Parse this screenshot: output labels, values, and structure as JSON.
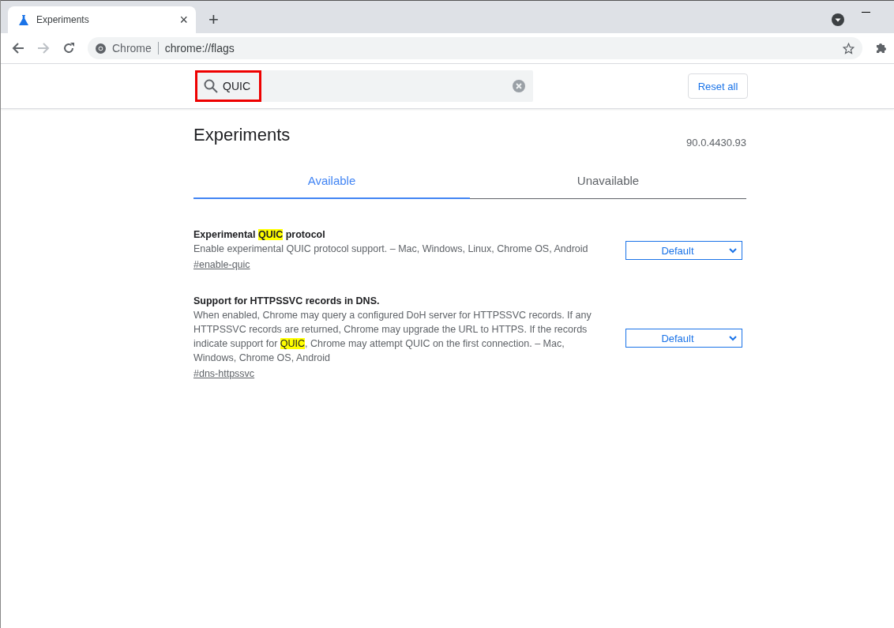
{
  "browser_tab": {
    "title": "Experiments",
    "close": "×"
  },
  "new_tab": "+",
  "address_bar": {
    "site": "Chrome",
    "url": "chrome://flags"
  },
  "search": {
    "value": "QUIC",
    "outlined": true
  },
  "reset_button": "Reset all",
  "heading": "Experiments",
  "version": "90.0.4430.93",
  "tabs": [
    {
      "label": "Available",
      "selected": true
    },
    {
      "label": "Unavailable",
      "selected": false
    }
  ],
  "flags": [
    {
      "title_parts": [
        {
          "text": "Experimental ",
          "highlight": false
        },
        {
          "text": "QUIC",
          "highlight": true
        },
        {
          "text": " protocol",
          "highlight": false
        }
      ],
      "description_parts": [
        {
          "text": "Enable experimental QUIC protocol support. – Mac, Windows, Linux, Chrome OS, Android",
          "highlight": false
        }
      ],
      "link": "#enable-quic",
      "value": "Default"
    },
    {
      "title_parts": [
        {
          "text": "Support for HTTPSSVC records in DNS.",
          "highlight": false
        }
      ],
      "description_parts": [
        {
          "text": "When enabled, Chrome may query a configured DoH server for HTTPSSVC records. If any HTTPSSVC records are returned, Chrome may upgrade the URL to HTTPS. If the records indicate support for ",
          "highlight": false
        },
        {
          "text": "QUIC",
          "highlight": true
        },
        {
          "text": ", Chrome may attempt QUIC on the first connection. – Mac, Windows, Chrome OS, Android",
          "highlight": false
        }
      ],
      "link": "#dns-httpssvc",
      "value": "Default"
    }
  ]
}
